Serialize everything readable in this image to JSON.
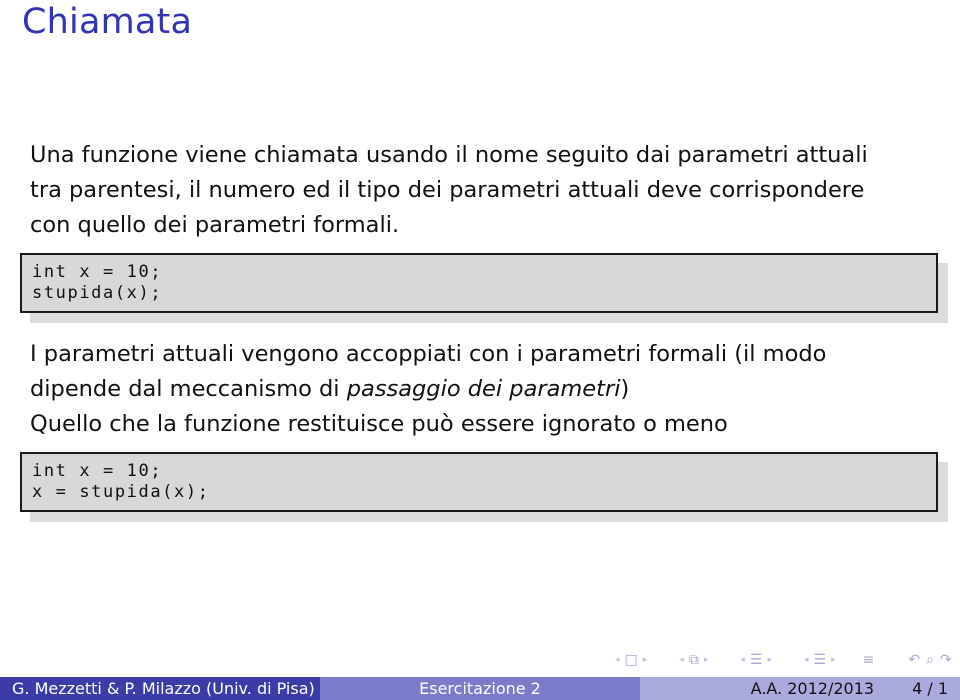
{
  "slide": {
    "title": "Chiamata",
    "paragraph1": {
      "lines": [
        "Una funzione viene chiamata usando il nome seguito dai parametri attuali",
        "tra parentesi, il numero ed il tipo dei parametri attuali deve corrispondere",
        "con quello dei parametri formali."
      ]
    },
    "code1": {
      "lines": [
        "int x = 10;",
        "stupida(x);"
      ]
    },
    "paragraph2": {
      "line1": "I parametri attuali vengono accoppiati con i parametri formali (il modo",
      "line2_before": "dipende dal meccanismo di ",
      "line2_emph": "passaggio dei parametri",
      "line2_after": ")",
      "line3": "Quello che la funzione restituisce può essere ignorato o meno"
    },
    "code2": {
      "lines": [
        "int x = 10;",
        "x = stupida(x);"
      ]
    }
  },
  "navigation": {
    "icons": [
      {
        "name": "frame-nav",
        "glyph": "□"
      },
      {
        "name": "subsection-nav",
        "glyph": "⧉"
      },
      {
        "name": "section-nav",
        "glyph": "☰"
      },
      {
        "name": "document-nav",
        "glyph": "☰"
      }
    ],
    "arrow_left": "◂",
    "arrow_right": "▸",
    "appendix_glyph": "≡",
    "back_glyph": "↶",
    "search_glyph": "⌕",
    "forward_glyph": "↷"
  },
  "footer": {
    "author": "G. Mezzetti & P. Milazzo  (Univ. di Pisa)",
    "title": "Esercitazione 2",
    "date": "A.A. 2012/2013",
    "page": "4 / 1"
  },
  "colors": {
    "title": "#3333b3",
    "footer_dark": "#3c3ca8",
    "footer_mid": "#7b7bcb",
    "footer_light": "#aaaadf",
    "code_bg": "#d8d8d8"
  }
}
